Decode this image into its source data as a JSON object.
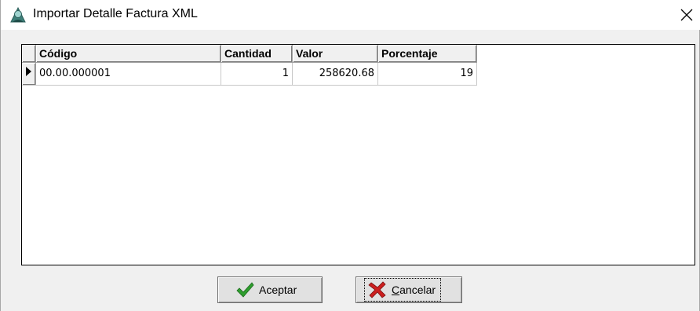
{
  "window": {
    "title": "Importar Detalle Factura XML",
    "icon": "app-icon",
    "close_icon": "close-icon"
  },
  "grid": {
    "columns": [
      "Código",
      "Cantidad",
      "Valor",
      "Porcentaje"
    ],
    "rows": [
      {
        "codigo": "00.00.000001",
        "cantidad": "1",
        "valor": "258620.68",
        "porcentaje": "19",
        "current": true
      }
    ]
  },
  "buttons": {
    "accept_label": "Aceptar",
    "accept_icon": "checkmark-icon",
    "cancel_label_prefix": "",
    "cancel_label_underlined": "C",
    "cancel_label_rest": "ancelar",
    "cancel_icon": "red-x-icon"
  },
  "colors": {
    "check_green": "#2f9e2f",
    "cancel_red": "#cc1f1f",
    "grid_border": "#000000"
  }
}
